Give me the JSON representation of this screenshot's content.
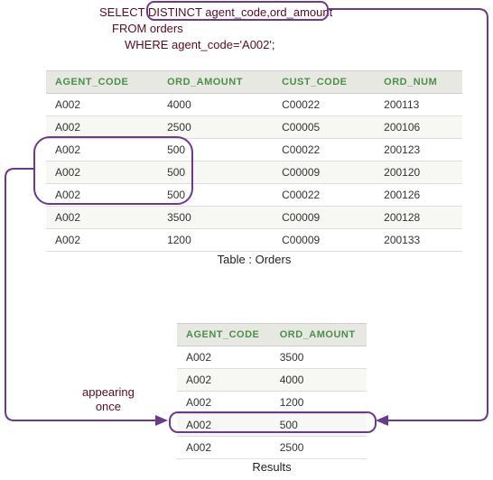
{
  "sql": {
    "line1_a": "SELECT ",
    "line1_b": "DISTINCT agent_code,ord_amount",
    "line2": "FROM orders",
    "line3": "WHERE agent_code='A002';"
  },
  "orders": {
    "caption": "Table : Orders",
    "headers": [
      "AGENT_CODE",
      "ORD_AMOUNT",
      "CUST_CODE",
      "ORD_NUM"
    ],
    "rows": [
      [
        "A002",
        "4000",
        "C00022",
        "200113"
      ],
      [
        "A002",
        "2500",
        "C00005",
        "200106"
      ],
      [
        "A002",
        "500",
        "C00022",
        "200123"
      ],
      [
        "A002",
        "500",
        "C00009",
        "200120"
      ],
      [
        "A002",
        "500",
        "C00022",
        "200126"
      ],
      [
        "A002",
        "3500",
        "C00009",
        "200128"
      ],
      [
        "A002",
        "1200",
        "C00009",
        "200133"
      ]
    ]
  },
  "results": {
    "caption": "Results",
    "headers": [
      "AGENT_CODE",
      "ORD_AMOUNT"
    ],
    "rows": [
      [
        "A002",
        "3500"
      ],
      [
        "A002",
        "4000"
      ],
      [
        "A002",
        "1200"
      ],
      [
        "A002",
        "500"
      ],
      [
        "A002",
        "2500"
      ]
    ]
  },
  "labels": {
    "appearing_line1": "appearing",
    "appearing_line2": "once"
  },
  "chart_data": {
    "type": "table",
    "description": "SQL DISTINCT illustration: source Orders table filtered by agent_code='A002', showing that DISTINCT on (agent_code, ord_amount) collapses three rows with ord_amount 500 into one row in Results.",
    "source_table": "orders",
    "distinct_columns": [
      "agent_code",
      "ord_amount"
    ],
    "highlighted_source_rows_indices": [
      2,
      3,
      4
    ],
    "highlighted_result_row_index": 3
  }
}
